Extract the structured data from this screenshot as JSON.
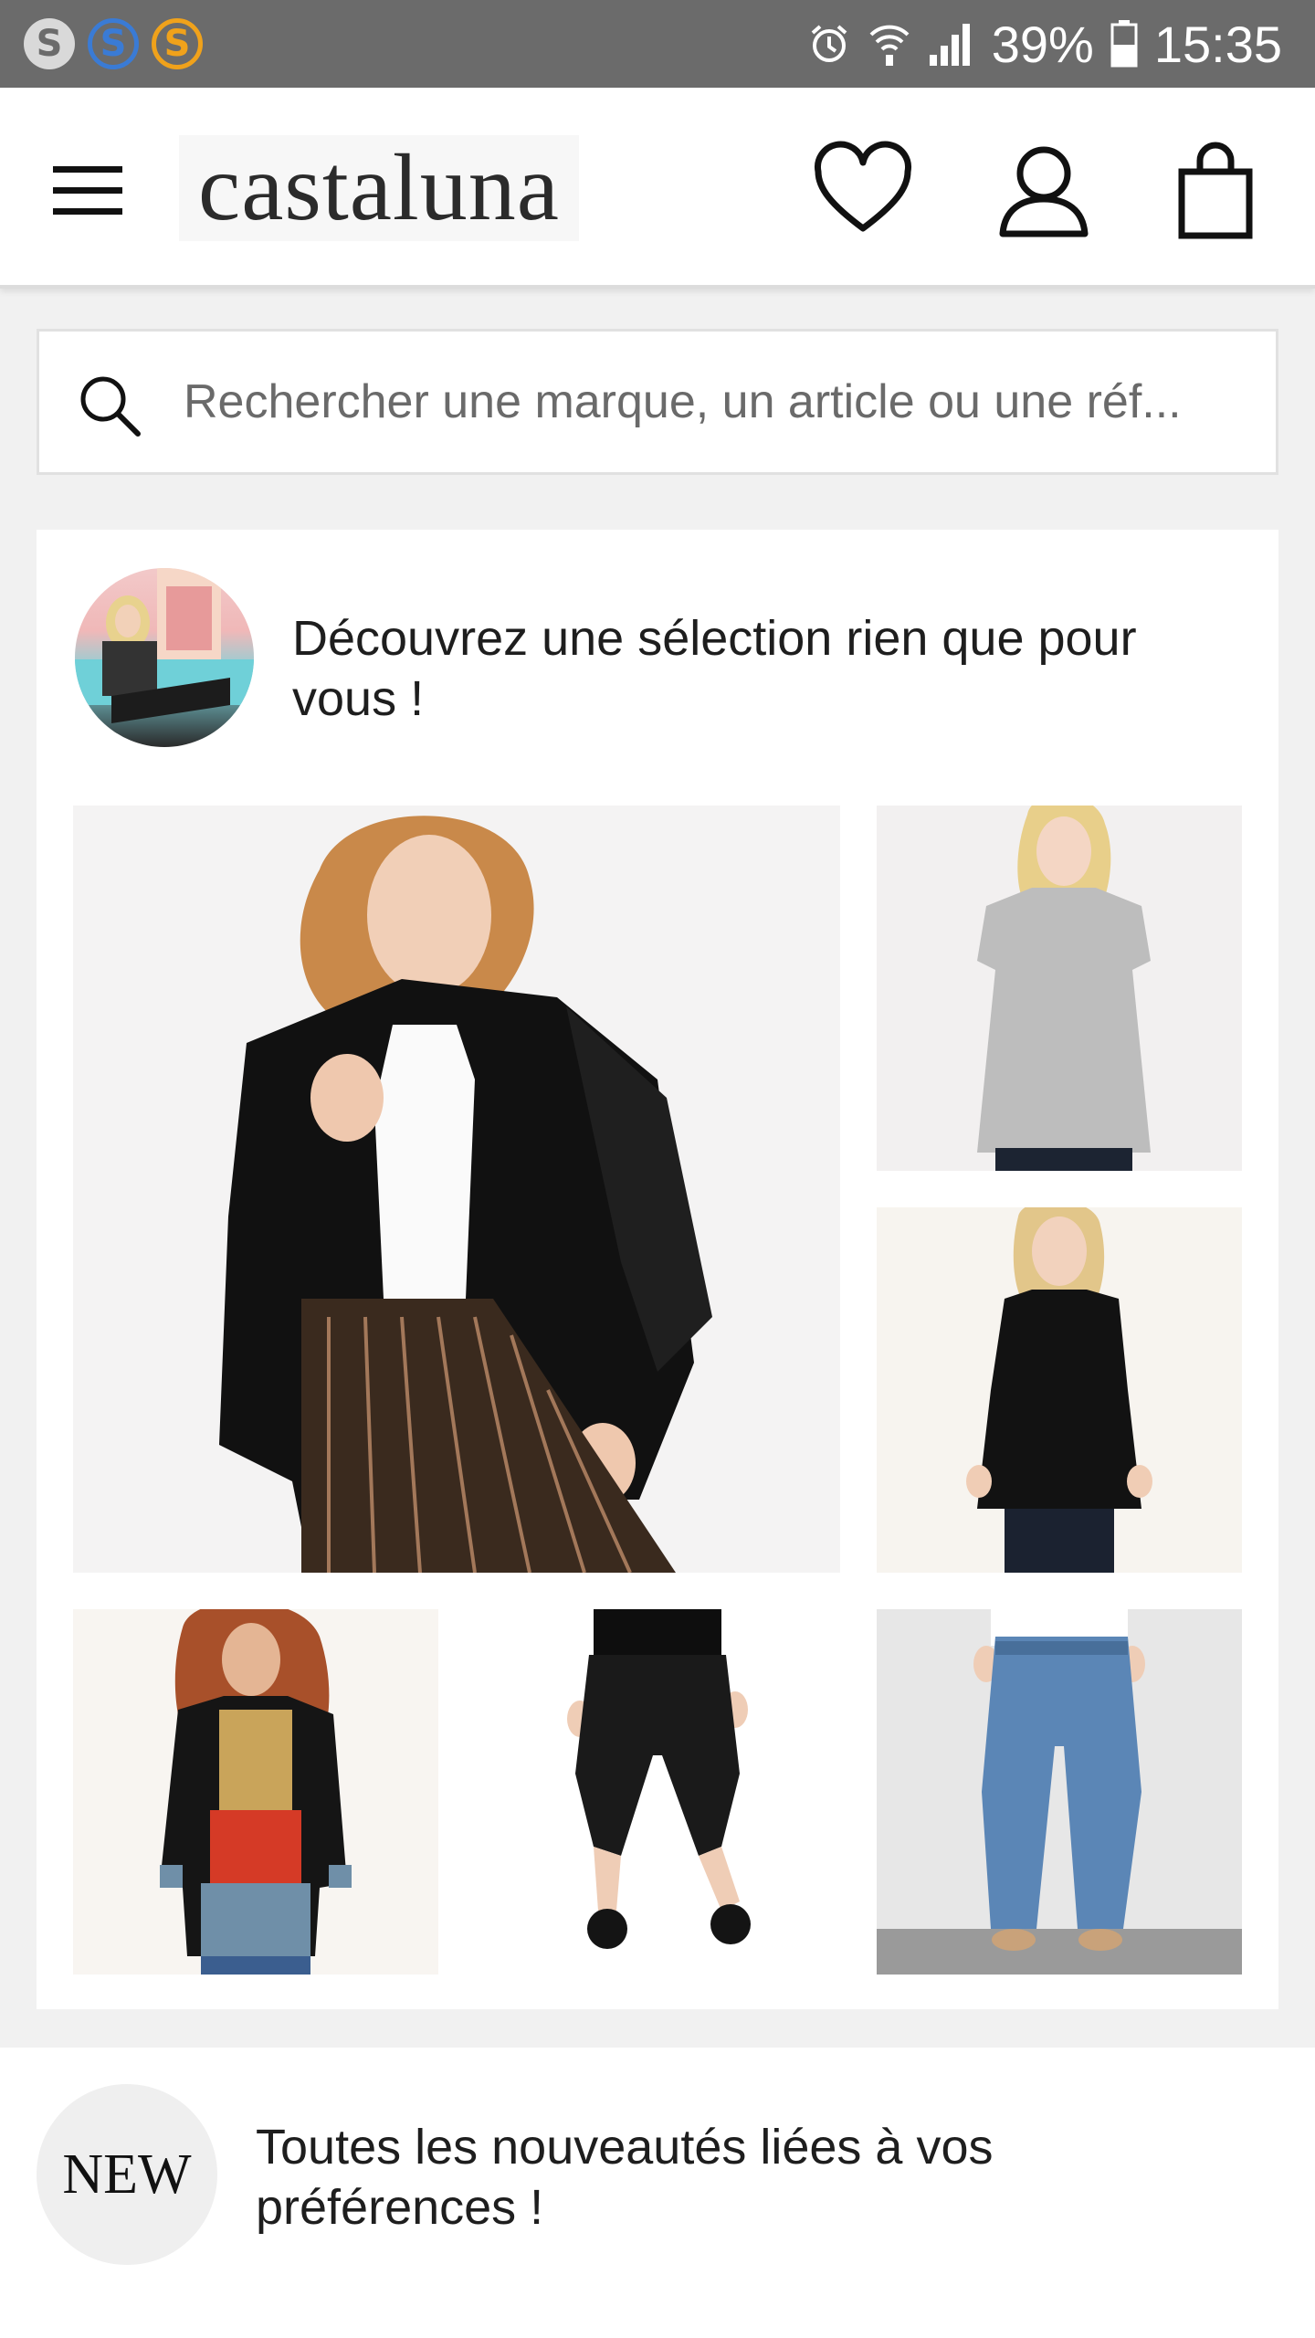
{
  "status_bar": {
    "apps": [
      {
        "icon": "skype-icon",
        "letter": "S",
        "bg": "#d9d9d9",
        "fg": "#6b6b6b"
      },
      {
        "icon": "skype-icon",
        "letter": "S",
        "bg": "transparent",
        "fg": "#3a7bd5"
      },
      {
        "icon": "skype-icon",
        "letter": "S",
        "bg": "transparent",
        "fg": "#f0a21b"
      }
    ],
    "battery": "39%",
    "time": "15:35"
  },
  "header": {
    "logo": "castaluna",
    "icons": [
      "hamburger-icon",
      "heart-icon",
      "account-icon",
      "bag-icon"
    ]
  },
  "search": {
    "placeholder": "Rechercher une marque, un article ou une réf..."
  },
  "selection": {
    "title": "Découvrez une sélection rien que pour vous !"
  },
  "new_section": {
    "badge": "NEW",
    "text": "Toutes les nouveautés liées à vos préférences !"
  },
  "colors": {
    "status_bar": "#6b6b6b",
    "page_bg": "#f1f1f1",
    "card_bg": "#ffffff",
    "text": "#1e1e1e"
  }
}
